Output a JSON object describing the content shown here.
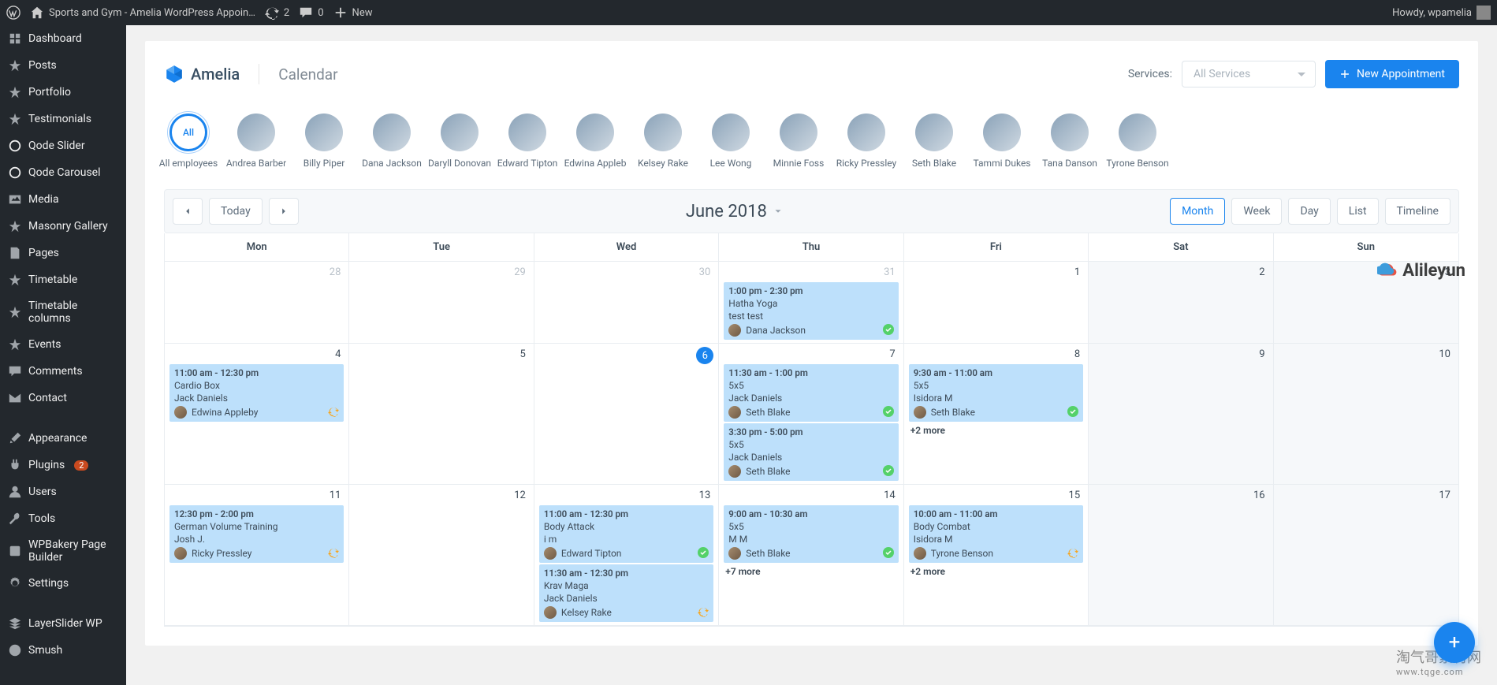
{
  "adminBar": {
    "siteTitle": "Sports and Gym - Amelia WordPress Appoin…",
    "updatesCount": "2",
    "commentsCount": "0",
    "newLabel": "New",
    "greeting": "Howdy, wpamelia"
  },
  "sidebar": {
    "items": [
      {
        "label": "Dashboard",
        "icon": "dashboard"
      },
      {
        "label": "Posts",
        "icon": "pin"
      },
      {
        "label": "Portfolio",
        "icon": "pin"
      },
      {
        "label": "Testimonials",
        "icon": "pin"
      },
      {
        "label": "Qode Slider",
        "icon": "qode"
      },
      {
        "label": "Qode Carousel",
        "icon": "qode"
      },
      {
        "label": "Media",
        "icon": "media"
      },
      {
        "label": "Masonry Gallery",
        "icon": "pin"
      },
      {
        "label": "Pages",
        "icon": "page"
      },
      {
        "label": "Timetable",
        "icon": "pin"
      },
      {
        "label": "Timetable columns",
        "icon": "pin"
      },
      {
        "label": "Events",
        "icon": "pin"
      },
      {
        "label": "Comments",
        "icon": "comment"
      },
      {
        "label": "Contact",
        "icon": "mail"
      },
      {
        "label": "Appearance",
        "icon": "brush"
      },
      {
        "label": "Plugins",
        "icon": "plug",
        "badge": "2"
      },
      {
        "label": "Users",
        "icon": "user"
      },
      {
        "label": "Tools",
        "icon": "wrench"
      },
      {
        "label": "WPBakery Page Builder",
        "icon": "wpbakery"
      },
      {
        "label": "Settings",
        "icon": "settings"
      },
      {
        "label": "LayerSlider WP",
        "icon": "layer"
      },
      {
        "label": "Smush",
        "icon": "smush"
      }
    ]
  },
  "header": {
    "brand": "Amelia",
    "pageTitle": "Calendar",
    "servicesLabel": "Services:",
    "servicesPlaceholder": "All Services",
    "newAppointment": "New Appointment"
  },
  "employees": [
    {
      "name": "All employees",
      "all": true,
      "short": "All"
    },
    {
      "name": "Andrea Barber"
    },
    {
      "name": "Billy Piper"
    },
    {
      "name": "Dana Jackson"
    },
    {
      "name": "Daryll Donovan"
    },
    {
      "name": "Edward Tipton"
    },
    {
      "name": "Edwina Appleb"
    },
    {
      "name": "Kelsey Rake"
    },
    {
      "name": "Lee Wong"
    },
    {
      "name": "Minnie Foss"
    },
    {
      "name": "Ricky Pressley"
    },
    {
      "name": "Seth Blake"
    },
    {
      "name": "Tammi Dukes"
    },
    {
      "name": "Tana Danson"
    },
    {
      "name": "Tyrone Benson"
    }
  ],
  "toolbar": {
    "today": "Today",
    "title": "June 2018",
    "views": [
      "Month",
      "Week",
      "Day",
      "List",
      "Timeline"
    ],
    "activeView": "Month"
  },
  "calendar": {
    "daysOfWeek": [
      "Mon",
      "Tue",
      "Wed",
      "Thu",
      "Fri",
      "Sat",
      "Sun"
    ],
    "rows": [
      [
        {
          "date": "28",
          "other": true
        },
        {
          "date": "29",
          "other": true
        },
        {
          "date": "30",
          "other": true
        },
        {
          "date": "31",
          "other": true,
          "events": [
            {
              "time": "1:00 pm - 2:30 pm",
              "svc": "Hatha Yoga",
              "cust": "test test",
              "emp": "Dana Jackson",
              "status": "ok"
            }
          ]
        },
        {
          "date": "1"
        },
        {
          "date": "2",
          "weekend": true
        },
        {
          "date": "3",
          "weekend": true
        }
      ],
      [
        {
          "date": "4",
          "events": [
            {
              "time": "11:00 am - 12:30 pm",
              "svc": "Cardio Box",
              "cust": "Jack Daniels",
              "emp": "Edwina Appleby",
              "status": "pend"
            }
          ]
        },
        {
          "date": "5"
        },
        {
          "date": "6",
          "today": true
        },
        {
          "date": "7",
          "events": [
            {
              "time": "11:30 am - 1:00 pm",
              "svc": "5x5",
              "cust": "Jack Daniels",
              "emp": "Seth Blake",
              "status": "ok"
            },
            {
              "time": "3:30 pm - 5:00 pm",
              "svc": "5x5",
              "cust": "Jack Daniels",
              "emp": "Seth Blake",
              "status": "ok"
            }
          ]
        },
        {
          "date": "8",
          "events": [
            {
              "time": "9:30 am - 11:00 am",
              "svc": "5x5",
              "cust": "Isidora M",
              "emp": "Seth Blake",
              "status": "ok"
            }
          ],
          "more": "+2 more"
        },
        {
          "date": "9",
          "weekend": true
        },
        {
          "date": "10",
          "weekend": true
        }
      ],
      [
        {
          "date": "11",
          "events": [
            {
              "time": "12:30 pm - 2:00 pm",
              "svc": "German Volume Training",
              "cust": "Josh J.",
              "emp": "Ricky Pressley",
              "status": "pend"
            }
          ]
        },
        {
          "date": "12"
        },
        {
          "date": "13",
          "events": [
            {
              "time": "11:00 am - 12:30 pm",
              "svc": "Body Attack",
              "cust": "i m",
              "emp": "Edward Tipton",
              "status": "ok"
            },
            {
              "time": "11:30 am - 12:30 pm",
              "svc": "Krav Maga",
              "cust": "Jack Daniels",
              "emp": "Kelsey Rake",
              "status": "pend"
            }
          ]
        },
        {
          "date": "14",
          "events": [
            {
              "time": "9:00 am - 10:30 am",
              "svc": "5x5",
              "cust": "M M",
              "emp": "Seth Blake",
              "status": "ok"
            }
          ],
          "more": "+7 more"
        },
        {
          "date": "15",
          "events": [
            {
              "time": "10:00 am - 11:00 am",
              "svc": "Body Combat",
              "cust": "Isidora M",
              "emp": "Tyrone Benson",
              "status": "pend"
            }
          ],
          "more": "+2 more"
        },
        {
          "date": "16",
          "weekend": true
        },
        {
          "date": "17",
          "weekend": true
        }
      ]
    ]
  },
  "watermark": {
    "w1": "Alileyun",
    "w2_a": "淘气哥素材网",
    "w2_b": "www.tqge.com"
  }
}
